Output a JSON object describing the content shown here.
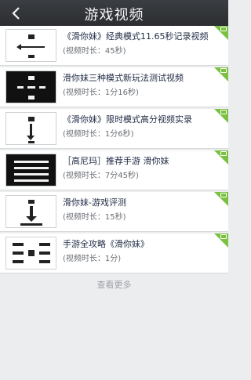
{
  "header": {
    "title": "游戏视频"
  },
  "videos": [
    {
      "title": "《滑你妹》经典模式11.65秒记录视频",
      "duration": "(视频时长：45秒)"
    },
    {
      "title": "滑你妹三种模式新玩法测试视频",
      "duration": "(视频时长：1分16秒)"
    },
    {
      "title": "《滑你妹》限时模式高分视频实录",
      "duration": "(视频时长：1分6秒)"
    },
    {
      "title": "［高尼玛］推荐手游 滑你妹",
      "duration": "(视频时长：7分45秒)"
    },
    {
      "title": "滑你妹-游戏评测",
      "duration": "(视频时长：15秒)"
    },
    {
      "title": "手游全攻略《滑你妹》",
      "duration": "(视频时长：1分)"
    }
  ],
  "load_more_label": "查看更多",
  "colors": {
    "header_bg": "#2f3235",
    "badge_green": "#7ac142",
    "title_text": "#1f2a44"
  },
  "icons": {
    "back": "back-arrow-icon",
    "badge": "video-badge-icon"
  }
}
